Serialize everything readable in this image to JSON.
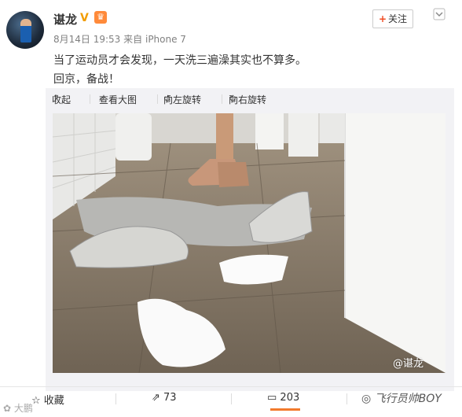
{
  "post": {
    "author": "谌龙",
    "verified_badge": "V",
    "member_icon": "crown-icon",
    "date": "8月14日 19:53",
    "source_prefix": "来自",
    "source": "iPhone 7",
    "follow_label": "关注",
    "text_line1": "当了运动员才会发现，一天洗三遍澡其实也不算多。",
    "text_line2": "回京，备战！"
  },
  "toolbar": {
    "collapse": "收起",
    "view_large": "查看大图",
    "rotate_left": "向左旋转",
    "rotate_right": "向右旋转"
  },
  "image": {
    "watermark": "@谌龙"
  },
  "footer": {
    "favorite": "收藏",
    "repost_count": "73",
    "comment_count": "203",
    "like_label": "",
    "accent_color": "#f27a2c"
  },
  "overlay": {
    "bottom_left_watermark": "",
    "bottom_right_watermark": "飞行员帅BOY"
  }
}
